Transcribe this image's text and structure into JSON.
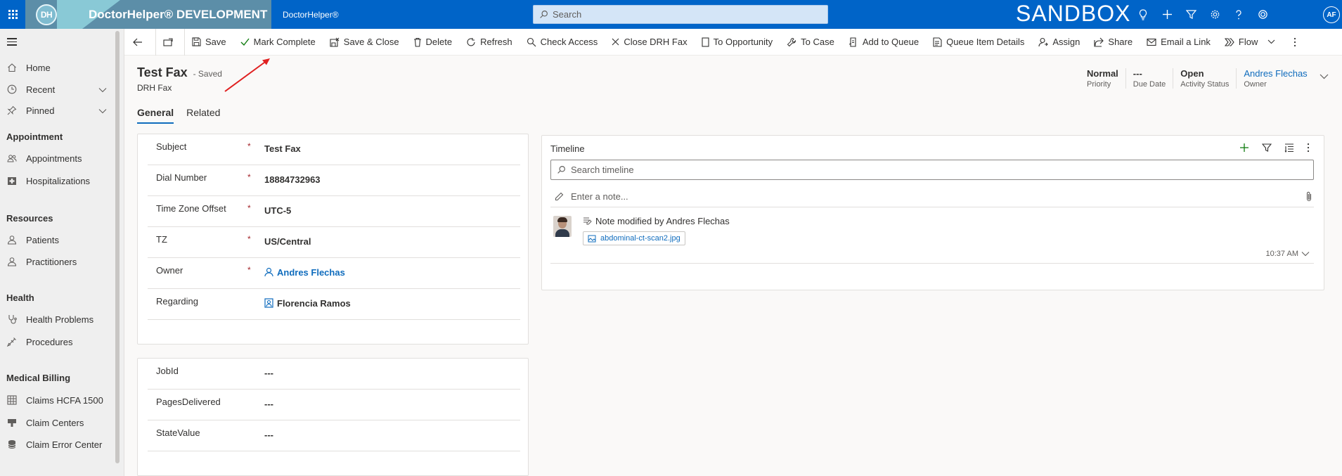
{
  "topbar": {
    "logo_text": "DH",
    "brand_title": "DoctorHelper® DEVELOPMENT",
    "app_name": "DoctorHelper®",
    "search_placeholder": "Search",
    "environment_label": "SANDBOX",
    "avatar_initials": "AF",
    "icons": [
      "lightbulb-icon",
      "plus-icon",
      "filter-icon",
      "gear-icon",
      "help-icon",
      "copilot-icon"
    ]
  },
  "sidebar": {
    "top_items": [
      {
        "label": "Home",
        "icon": "home-icon"
      },
      {
        "label": "Recent",
        "icon": "clock-icon"
      },
      {
        "label": "Pinned",
        "icon": "pin-icon"
      }
    ],
    "groups": [
      {
        "title": "Appointment",
        "items": [
          {
            "label": "Appointments",
            "icon": "people-icon"
          },
          {
            "label": "Hospitalizations",
            "icon": "hospital-icon"
          }
        ]
      },
      {
        "title": "Resources",
        "items": [
          {
            "label": "Patients",
            "icon": "person-icon"
          },
          {
            "label": "Practitioners",
            "icon": "person-icon"
          }
        ]
      },
      {
        "title": "Health",
        "items": [
          {
            "label": "Health Problems",
            "icon": "stethoscope-icon"
          },
          {
            "label": "Procedures",
            "icon": "syringe-icon"
          }
        ]
      },
      {
        "title": "Medical Billing",
        "items": [
          {
            "label": "Claims HCFA 1500",
            "icon": "grid-icon"
          },
          {
            "label": "Claim Centers",
            "icon": "stamp-icon"
          },
          {
            "label": "Claim Error Center",
            "icon": "database-icon"
          }
        ]
      }
    ]
  },
  "commandbar": {
    "items": [
      {
        "label": "Save",
        "icon": "save-icon"
      },
      {
        "label": "Mark Complete",
        "icon": "checkmark-icon"
      },
      {
        "label": "Save & Close",
        "icon": "save-close-icon"
      },
      {
        "label": "Delete",
        "icon": "trash-icon"
      },
      {
        "label": "Refresh",
        "icon": "refresh-icon"
      },
      {
        "label": "Check Access",
        "icon": "search-person-icon"
      },
      {
        "label": "Close DRH Fax",
        "icon": "close-icon"
      },
      {
        "label": "To Opportunity",
        "icon": "document-icon"
      },
      {
        "label": "To Case",
        "icon": "wrench-icon"
      },
      {
        "label": "Add to Queue",
        "icon": "queue-add-icon"
      },
      {
        "label": "Queue Item Details",
        "icon": "queue-details-icon"
      },
      {
        "label": "Assign",
        "icon": "assign-icon"
      },
      {
        "label": "Share",
        "icon": "share-icon"
      },
      {
        "label": "Email a Link",
        "icon": "email-icon"
      },
      {
        "label": "Flow",
        "icon": "flow-icon"
      }
    ]
  },
  "record": {
    "title": "Test Fax",
    "save_status": "- Saved",
    "entity": "DRH Fax",
    "header_fields": [
      {
        "value": "Normal",
        "label": "Priority"
      },
      {
        "value": "---",
        "label": "Due Date"
      },
      {
        "value": "Open",
        "label": "Activity Status"
      },
      {
        "value": "Andres Flechas",
        "label": "Owner"
      }
    ]
  },
  "tabs": [
    {
      "label": "General",
      "active": true
    },
    {
      "label": "Related",
      "active": false
    }
  ],
  "general_section": {
    "fields": [
      {
        "label": "Subject",
        "required": "*",
        "value": "Test Fax"
      },
      {
        "label": "Dial Number",
        "required": "*",
        "value": "18884732963"
      },
      {
        "label": "Time Zone Offset",
        "required": "*",
        "value": "UTC-5"
      },
      {
        "label": "TZ",
        "required": "*",
        "value": "US/Central"
      },
      {
        "label": "Owner",
        "required": "*",
        "value": "Andres Flechas"
      },
      {
        "label": "Regarding",
        "required": "",
        "value": "Florencia Ramos"
      }
    ]
  },
  "job_section": {
    "fields": [
      {
        "label": "JobId",
        "value": "---"
      },
      {
        "label": "PagesDelivered",
        "value": "---"
      },
      {
        "label": "StateValue",
        "value": "---"
      }
    ]
  },
  "timeline": {
    "title": "Timeline",
    "search_placeholder": "Search timeline",
    "note_placeholder": "Enter a note...",
    "entries": [
      {
        "heading": "Note modified by Andres Flechas",
        "attachment": "abdominal-ct-scan2.jpg",
        "time": "10:37 AM"
      }
    ]
  },
  "colors": {
    "topbar": "#0064c8",
    "link": "#0f6cbd",
    "annotation_arrow": "#e02020"
  }
}
